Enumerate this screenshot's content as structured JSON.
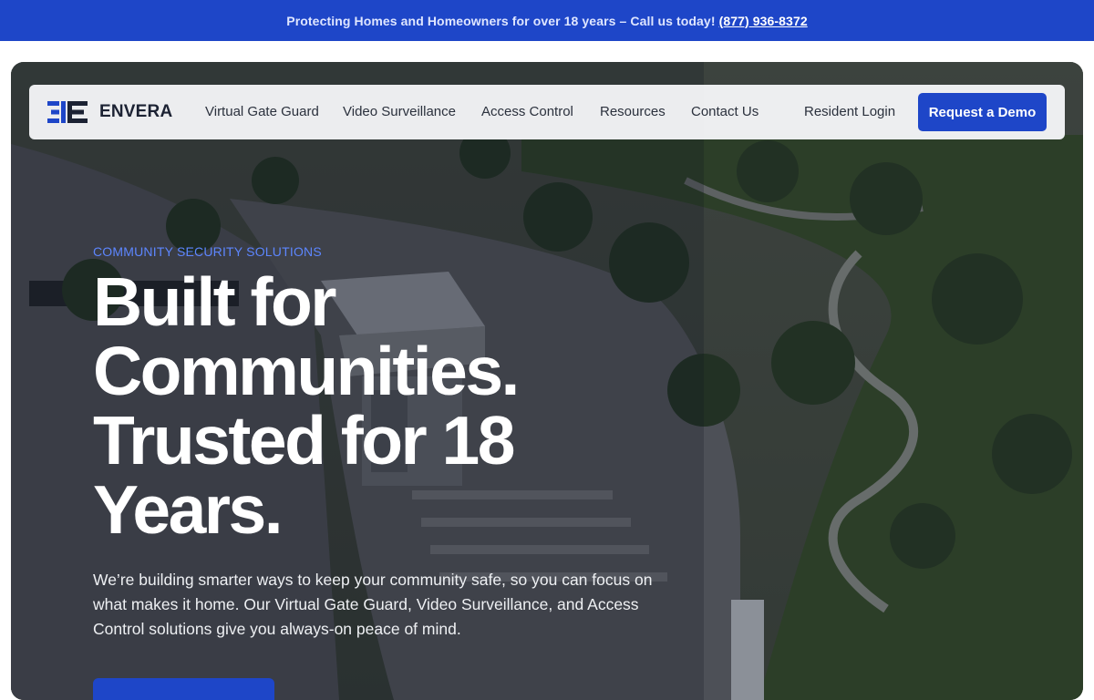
{
  "announcement": {
    "text": "Protecting Homes and Homeowners for over 18 years – Call us today!",
    "phone": "(877) 936-8372"
  },
  "brand": {
    "name": "ENVERA",
    "logo_icon": "envera-ee-logo-icon"
  },
  "nav": {
    "items": [
      {
        "label": "Virtual Gate Guard"
      },
      {
        "label": "Video Surveillance"
      },
      {
        "label": "Access Control"
      },
      {
        "label": "Resources"
      },
      {
        "label": "Contact Us"
      }
    ],
    "resident_login": "Resident Login",
    "cta": "Request a Demo"
  },
  "hero": {
    "eyebrow": "COMMUNITY SECURITY SOLUTIONS",
    "headline": "Built for Communities. Trusted for 18 Years.",
    "description": "We’re building smarter ways to keep your community safe, so you can focus on what makes it home. Our Virtual Gate Guard, Video Surveillance, and Access Control solutions give you always-on peace of mind."
  },
  "colors": {
    "brand_blue": "#1e46c8",
    "eyebrow_blue": "#5d86ff",
    "nav_bg": "#f3f4f6"
  }
}
